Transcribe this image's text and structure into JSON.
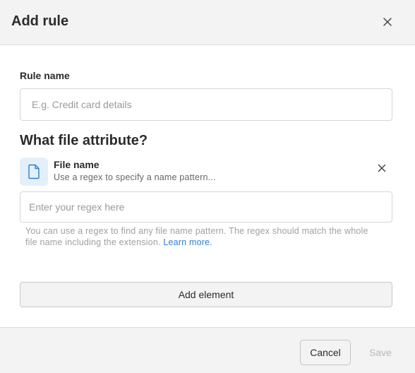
{
  "dialog": {
    "title": "Add rule",
    "close_icon": "close-icon"
  },
  "rule_name": {
    "label": "Rule name",
    "value": "",
    "placeholder": "E.g. Credit card details"
  },
  "attribute_section": {
    "title": "What file attribute?",
    "attribute": {
      "icon": "file-icon",
      "name": "File name",
      "description": "Use a regex to specify a name pattern...",
      "remove_icon": "close-icon"
    },
    "regex_input": {
      "value": "",
      "placeholder": "Enter your regex here"
    },
    "help_text": "You can use a regex to find any file name pattern. The regex should match the whole file name including the extension.",
    "help_link": "Learn more."
  },
  "add_element_label": "Add element",
  "footer": {
    "cancel_label": "Cancel",
    "save_label": "Save"
  },
  "colors": {
    "header_bg": "#f3f3f3",
    "icon_box_bg": "#e3f0fb",
    "icon_stroke": "#2f7fcf",
    "link": "#2f7fcf",
    "disabled_text": "#b8b8b8"
  }
}
